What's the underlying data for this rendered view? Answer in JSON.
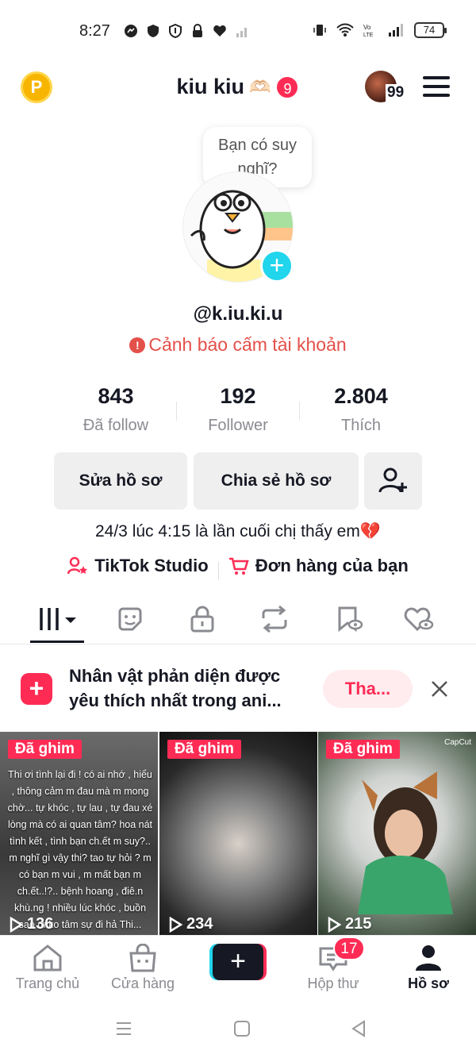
{
  "status_bar": {
    "time": "8:27",
    "battery": "74"
  },
  "header": {
    "coin_label": "P",
    "title": "kiu kiu",
    "title_emoji": "🫶🏻",
    "badge_count": "9",
    "avatar_count": "99"
  },
  "bubble": {
    "text": "Bạn có suy nghĩ?"
  },
  "profile": {
    "handle": "@k.iu.ki.u",
    "warning": "Cảnh báo cấm tài khoản",
    "warning_icon": "!"
  },
  "stats": [
    {
      "value": "843",
      "label": "Đã follow"
    },
    {
      "value": "192",
      "label": "Follower"
    },
    {
      "value": "2.804",
      "label": "Thích"
    }
  ],
  "buttons": {
    "edit": "Sửa hồ sơ",
    "share": "Chia sẻ hồ sơ"
  },
  "bio": "24/3 lúc 4:15 là lần cuối chị thấy em💔",
  "links": {
    "studio": "TikTok Studio",
    "orders": "Đơn hàng của bạn"
  },
  "tabs": [
    "videos-grid-icon",
    "sticker-icon",
    "lock-icon",
    "repost-icon",
    "saved-eye-icon",
    "liked-heart-icon"
  ],
  "suggestion": {
    "title": "Nhân vật phản diện được yêu thích nhất trong ani...",
    "button": "Tha...",
    "icon_label": "+"
  },
  "videos": [
    {
      "pinned": "Đã ghim",
      "views": "136",
      "caption": "Thi ơi tình lại đi ! có ai nhớ , hiểu , thông cảm m đau mà m mong chờ... tự khóc , tự lau , tự đau xé lòng mà có ai quan tâm? hoa nát tình kết , tình bạn ch.ết m suy?.. m nghĩ gì vậy thi? tao tự hỏi ? m có bạn m vui , m mất bạn m ch.ết..!?.. bệnh hoang , điê.n khù.ng ! nhiều lúc khóc , buồn sao m ko tâm sự đi hả Thi..."
    },
    {
      "pinned": "Đã ghim",
      "views": "234"
    },
    {
      "pinned": "Đã ghim",
      "views": "215",
      "watermark": "CapCut"
    }
  ],
  "bottom_nav": {
    "home": "Trang chủ",
    "shop": "Cửa hàng",
    "inbox": "Hộp thư",
    "inbox_badge": "17",
    "profile": "Hồ sơ"
  },
  "colors": {
    "accent": "#fe2c55",
    "cyan": "#20d5ec",
    "warning": "#e4504a"
  }
}
